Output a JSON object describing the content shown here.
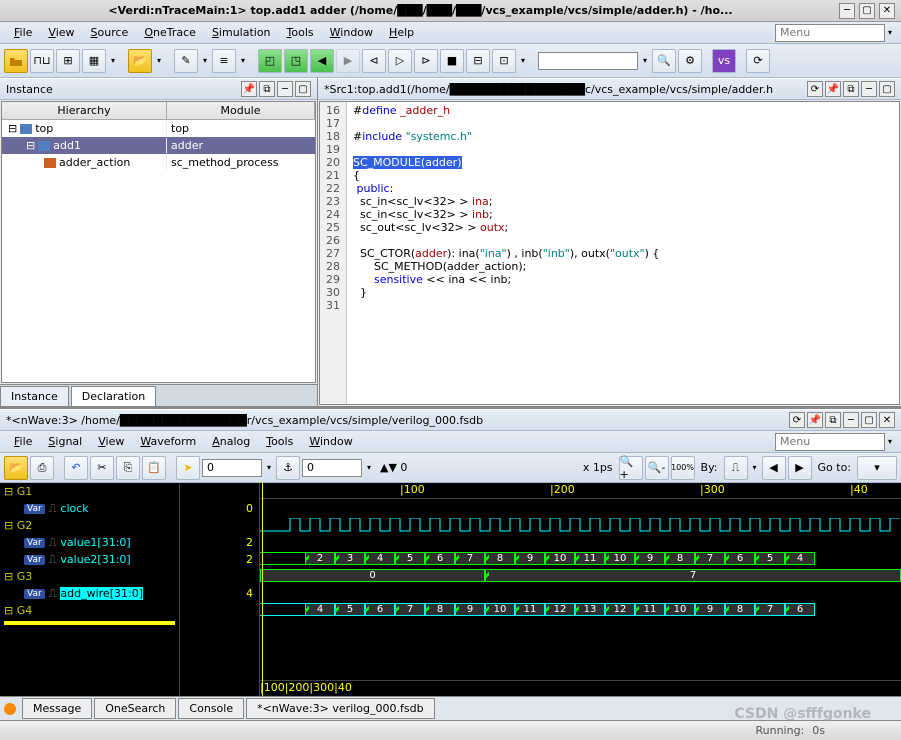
{
  "window": {
    "title": "<Verdi:nTraceMain:1> top.add1 adder (/home/███/███/███/vcs_example/vcs/simple/adder.h) - /ho..."
  },
  "menubar_main": {
    "items": [
      "File",
      "View",
      "Source",
      "OneTrace",
      "Simulation",
      "Tools",
      "Window",
      "Help"
    ],
    "search_placeholder": "Menu"
  },
  "instance_pane": {
    "title": "Instance",
    "col_hierarchy": "Hierarchy",
    "col_module": "Module",
    "rows": [
      {
        "name": "top",
        "module": "top",
        "indent": 0,
        "sel": false
      },
      {
        "name": "add1",
        "module": "adder",
        "indent": 1,
        "sel": true
      },
      {
        "name": "adder_action",
        "module": "sc_method_process",
        "indent": 2,
        "sel": false
      }
    ],
    "tabs": [
      "Instance",
      "Declaration"
    ],
    "active_tab": 1
  },
  "source_pane": {
    "title": "*Src1:top.add1(/home/████████████████c/vcs_example/vcs/simple/adder.h",
    "lines": [
      {
        "n": 16,
        "html": "#<span class='kw1'>define</span> <span class='kw2'>_adder_h</span>"
      },
      {
        "n": 17,
        "html": ""
      },
      {
        "n": 18,
        "html": "#<span class='kw1'>include</span> <span class='str'>\"systemc.h\"</span>"
      },
      {
        "n": 19,
        "html": ""
      },
      {
        "n": 20,
        "html": "<span class='hl'>SC_MODULE(adder)</span>"
      },
      {
        "n": 21,
        "html": "{"
      },
      {
        "n": 22,
        "html": "&nbsp;<span class='kw1'>public</span>:"
      },
      {
        "n": 23,
        "html": "&nbsp;&nbsp;sc_in&lt;sc_lv&lt;32&gt; &gt; <span class='kw2'>ina</span>;"
      },
      {
        "n": 24,
        "html": "&nbsp;&nbsp;sc_in&lt;sc_lv&lt;32&gt; &gt; <span class='kw2'>inb</span>;"
      },
      {
        "n": 25,
        "html": "&nbsp;&nbsp;sc_out&lt;sc_lv&lt;32&gt; &gt; <span class='kw2'>outx</span>;"
      },
      {
        "n": 26,
        "html": ""
      },
      {
        "n": 27,
        "html": "&nbsp;&nbsp;SC_CTOR(<span class='kw2'>adder</span>): ina(<span class='str'>\"ina\"</span>) , inb(<span class='str'>\"inb\"</span>), outx(<span class='str'>\"outx\"</span>) {"
      },
      {
        "n": 28,
        "html": "&nbsp;&nbsp;&nbsp;&nbsp;&nbsp;&nbsp;SC_METHOD(adder_action);"
      },
      {
        "n": 29,
        "html": "&nbsp;&nbsp;&nbsp;&nbsp;&nbsp;&nbsp;<span class='kw1'>sensitive</span> &lt;&lt; ina &lt;&lt; inb;"
      },
      {
        "n": 30,
        "html": "&nbsp;&nbsp;}"
      },
      {
        "n": 31,
        "html": ""
      }
    ]
  },
  "wave_window": {
    "title": "*<nWave:3> /home/███████████████r/vcs_example/vcs/simple/verilog_000.fsdb",
    "menubar": [
      "File",
      "Signal",
      "View",
      "Waveform",
      "Analog",
      "Tools",
      "Window"
    ],
    "search_placeholder": "Menu",
    "cursor1": "0",
    "cursor2": "0",
    "delta_label": "▲▼ 0",
    "timescale": "x 1ps",
    "by_label": "By:",
    "goto_label": "Go to:",
    "zoom_100": "100%"
  },
  "signals": {
    "groups": [
      {
        "name": "G1",
        "items": [
          {
            "name": "clock",
            "val": "0"
          }
        ]
      },
      {
        "name": "G2",
        "items": [
          {
            "name": "value1[31:0]",
            "val": "2"
          },
          {
            "name": "value2[31:0]",
            "val": "2"
          }
        ]
      },
      {
        "name": "G3",
        "items": [
          {
            "name": "add_wire[31:0]",
            "val": "4",
            "hl": true
          }
        ]
      },
      {
        "name": "G4",
        "items": []
      }
    ]
  },
  "ruler_ticks": [
    "100",
    "200",
    "300",
    "40"
  ],
  "chart_data": {
    "type": "waveform",
    "timescale": "1ps",
    "cursor_pos": 0,
    "bus_value1": {
      "values": [
        2,
        3,
        4,
        5,
        6,
        7,
        8,
        9,
        10,
        11,
        10,
        9,
        8,
        7,
        6,
        5,
        4
      ],
      "start": 30,
      "step": 20
    },
    "bus_value2": {
      "initial": 0,
      "change_at": 150,
      "change_to": 7
    },
    "bus_addwire": {
      "values": [
        4,
        5,
        6,
        7,
        8,
        9,
        10,
        11,
        12,
        13,
        12,
        11,
        10,
        9,
        8,
        7,
        6
      ],
      "start": 30,
      "step": 20,
      "color": "#00ffff"
    }
  },
  "bottom_tabs": {
    "items": [
      "Message",
      "OneSearch",
      "Console",
      "*<nWave:3> verilog_000.fsdb"
    ]
  },
  "status": {
    "running": "Running:",
    "time": "0s",
    "watermark": "CSDN @sfffgonke"
  }
}
